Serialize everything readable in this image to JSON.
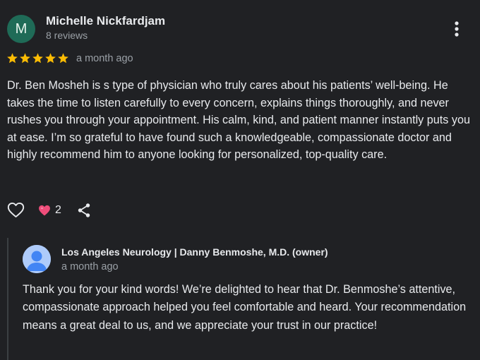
{
  "review": {
    "author": {
      "initial": "M",
      "name": "Michelle Nickfardjam",
      "meta": "8 reviews",
      "avatar_color": "#1f6b57"
    },
    "rating": 5,
    "rating_max": 5,
    "star_color": "#fbbc04",
    "date": "a month ago",
    "text": "Dr. Ben Mosheh is s type of physician who truly cares about his patients’ well-being. He takes the time to listen carefully to every concern, explains things thoroughly, and never rushes you through your appointment. His calm, kind, and patient manner instantly puts you at ease. I’m so grateful to have found such a knowledgeable, compassionate doctor and highly recommend him to anyone looking for personalized, top-quality care.",
    "actions": {
      "like_icon": "heart-outline-icon",
      "reaction_icon": "heart-filled-icon",
      "reaction_color": "#ee4d7a",
      "reaction_count": "2",
      "share_icon": "share-icon"
    }
  },
  "owner_reply": {
    "name": "Los Angeles Neurology | Danny Benmoshe, M.D. (owner)",
    "date": "a month ago",
    "text": "Thank you for your kind words! We’re delighted to hear that Dr. Benmoshe’s attentive, compassionate approach helped you feel comfortable and heard. Your recommendation means a great deal to us, and we appreciate your trust in our practice!"
  }
}
